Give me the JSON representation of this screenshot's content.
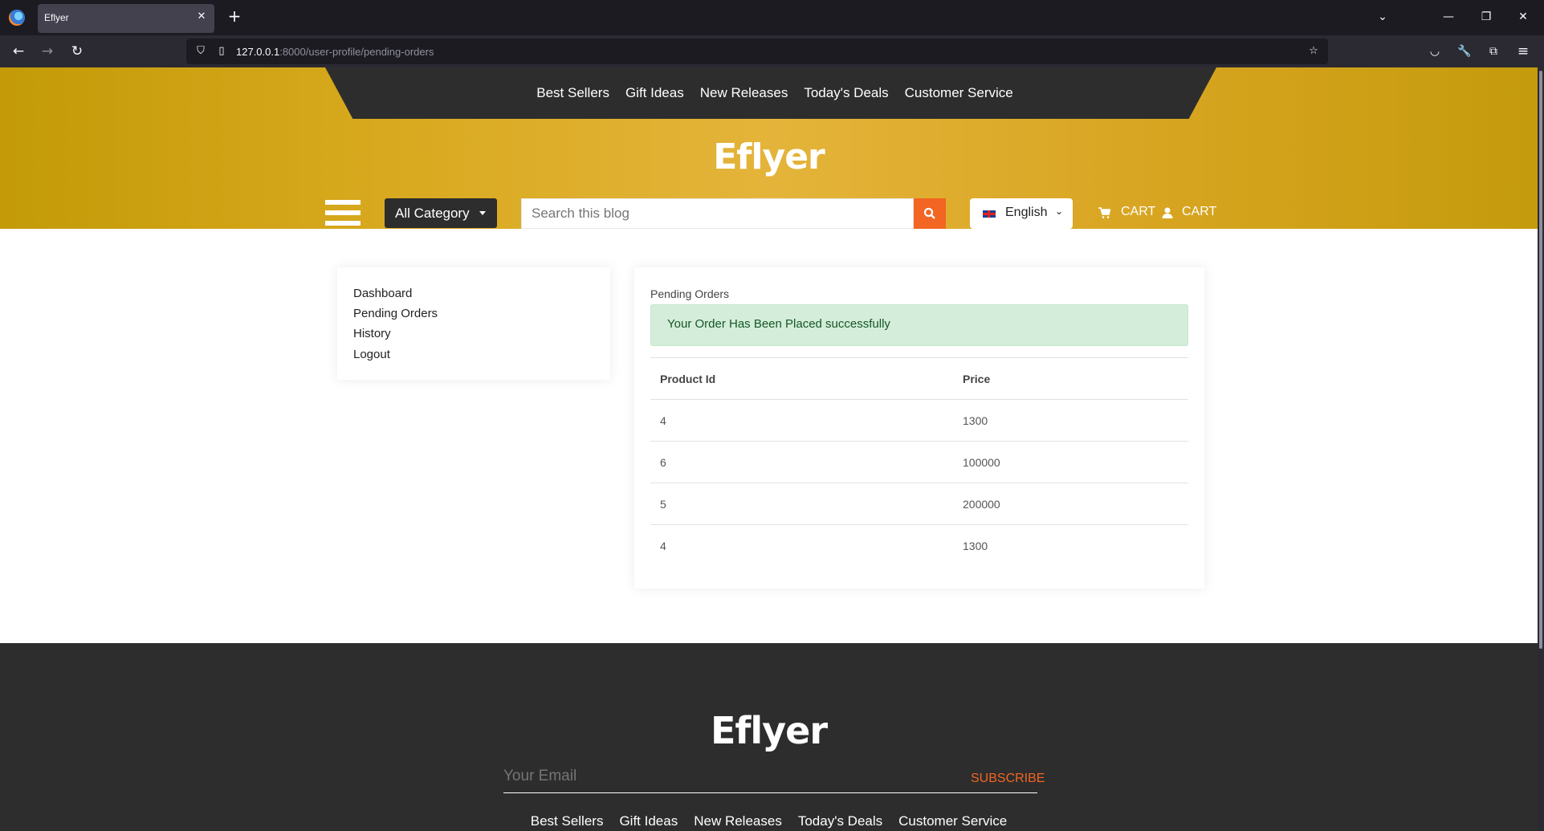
{
  "browser": {
    "tab_title": "Eflyer",
    "url_host": "127.0.0.1",
    "url_path": ":8000/user-profile/pending-orders"
  },
  "site": {
    "brand": "Eflyer",
    "top_nav": [
      "Best Sellers",
      "Gift Ideas",
      "New Releases",
      "Today's Deals",
      "Customer Service"
    ],
    "category_label": "All Category",
    "search_placeholder": "Search this blog",
    "language": "English",
    "cart_label_1": "CART",
    "cart_label_2": "CART",
    "accent_color": "#f26522",
    "hero_color": "#d8a91e",
    "dark_color": "#2d2d2d"
  },
  "sidebar": {
    "items": [
      "Dashboard",
      "Pending Orders",
      "History",
      "Logout"
    ]
  },
  "main": {
    "title": "Pending Orders",
    "alert": "Your Order Has Been Placed successfully",
    "columns": [
      "Product Id",
      "Price"
    ],
    "rows": [
      {
        "id": "4",
        "price": "1300"
      },
      {
        "id": "6",
        "price": "100000"
      },
      {
        "id": "5",
        "price": "200000"
      },
      {
        "id": "4",
        "price": "1300"
      }
    ]
  },
  "footer": {
    "brand": "Eflyer",
    "email_placeholder": "Your Email",
    "subscribe_label": "SUBSCRIBE",
    "nav": [
      "Best Sellers",
      "Gift Ideas",
      "New Releases",
      "Today's Deals",
      "Customer Service"
    ]
  }
}
